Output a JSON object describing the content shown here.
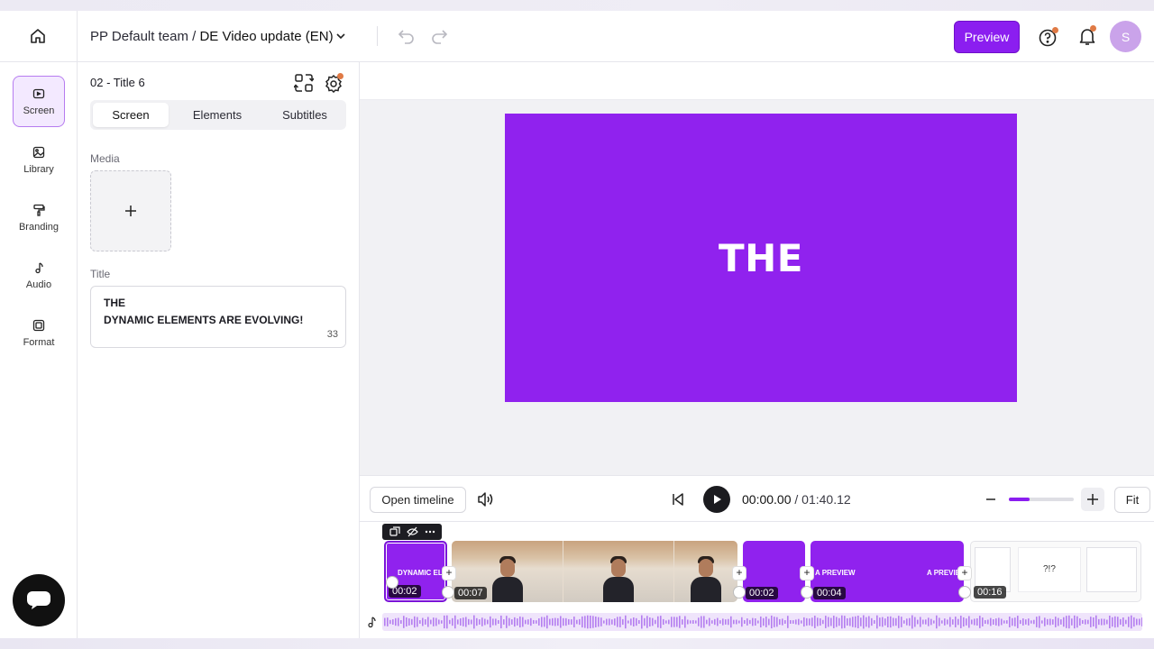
{
  "header": {
    "team": "PP Default team / ",
    "project": "DE Video update (EN)",
    "preview_label": "Preview",
    "avatar_initial": "S"
  },
  "rail": {
    "items": [
      {
        "label": "Screen",
        "icon": "screen-icon",
        "active": true
      },
      {
        "label": "Library",
        "icon": "image-icon"
      },
      {
        "label": "Branding",
        "icon": "paint-roller-icon"
      },
      {
        "label": "Audio",
        "icon": "music-note-icon"
      },
      {
        "label": "Format",
        "icon": "format-icon"
      }
    ]
  },
  "panel": {
    "title": "02 - Title 6",
    "tabs": [
      "Screen",
      "Elements",
      "Subtitles"
    ],
    "active_tab": "Screen",
    "media_label": "Media",
    "title_label": "Title",
    "title_line1": "THE",
    "title_line2": "DYNAMIC ELEMENTS ARE EVOLVING!",
    "char_count": "33"
  },
  "canvas": {
    "slide_text": "THE",
    "slide_color": "#9022ee"
  },
  "player": {
    "open_timeline_label": "Open timeline",
    "current_time": "00:00.00",
    "separator": " / ",
    "total_time": "01:40.12",
    "fit_label": "Fit",
    "zoom_level": 0.32
  },
  "timeline": {
    "clips": [
      {
        "type": "title",
        "label": "DYNAMIC ELE",
        "duration": "00:02"
      },
      {
        "type": "video",
        "duration": "00:07"
      },
      {
        "type": "title",
        "duration": "00:02"
      },
      {
        "type": "title",
        "label_left": "A PREVIEW",
        "label_right": "A PREVIEW",
        "duration": "00:04"
      },
      {
        "type": "screen",
        "label": "?!?",
        "duration": "00:16"
      }
    ]
  },
  "colors": {
    "accent": "#8b1ef0",
    "notification": "#e07a45"
  }
}
